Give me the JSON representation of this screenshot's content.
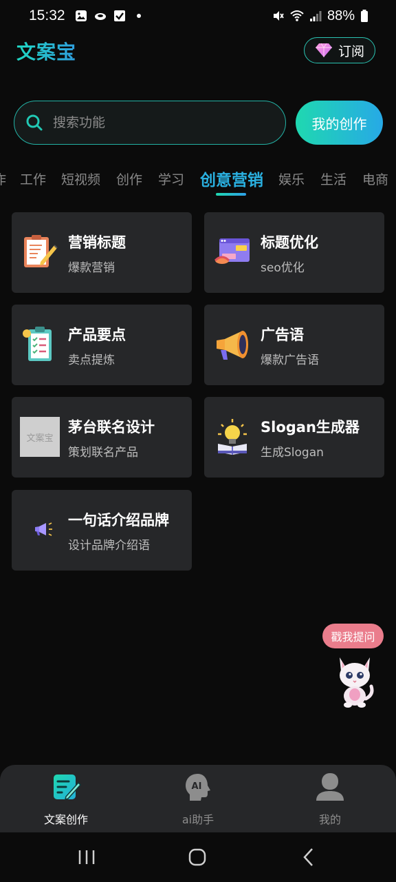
{
  "status_bar": {
    "time": "15:32",
    "battery": "88%"
  },
  "header": {
    "logo": "文案宝",
    "subscribe_label": "订阅"
  },
  "search": {
    "placeholder": "搜索功能",
    "creation_button": "我的创作"
  },
  "tabs": [
    {
      "label": "作"
    },
    {
      "label": "工作"
    },
    {
      "label": "短视频"
    },
    {
      "label": "创作"
    },
    {
      "label": "学习"
    },
    {
      "label": "创意营销",
      "active": true
    },
    {
      "label": "娱乐"
    },
    {
      "label": "生活"
    },
    {
      "label": "电商"
    }
  ],
  "cards": [
    {
      "title": "营销标题",
      "subtitle": "爆款营销",
      "icon": "clipboard-pencil-icon"
    },
    {
      "title": "标题优化",
      "subtitle": "seo优化",
      "icon": "web-browser-icon"
    },
    {
      "title": "产品要点",
      "subtitle": "卖点提炼",
      "icon": "checklist-icon"
    },
    {
      "title": "广告语",
      "subtitle": "爆款广告语",
      "icon": "megaphone-icon"
    },
    {
      "title": "茅台联名设计",
      "subtitle": "策划联名产品",
      "icon": "placeholder-image",
      "placeholder_text": "文案宝"
    },
    {
      "title": "Slogan生成器",
      "subtitle": "生成Slogan",
      "icon": "lightbulb-book-icon"
    },
    {
      "title": "一句话介绍品牌",
      "subtitle": "设计品牌介绍语",
      "icon": "small-megaphone-icon"
    }
  ],
  "help": {
    "label": "戳我提问"
  },
  "bottom_nav": [
    {
      "label": "文案创作",
      "icon": "edit-document-icon",
      "active": true
    },
    {
      "label": "ai助手",
      "icon": "ai-head-icon"
    },
    {
      "label": "我的",
      "icon": "user-icon"
    }
  ],
  "colors": {
    "accent_teal": "#1fd8b0",
    "accent_blue": "#2ab0e0",
    "card_bg": "#262729",
    "help_pink": "#ea7d8c"
  }
}
